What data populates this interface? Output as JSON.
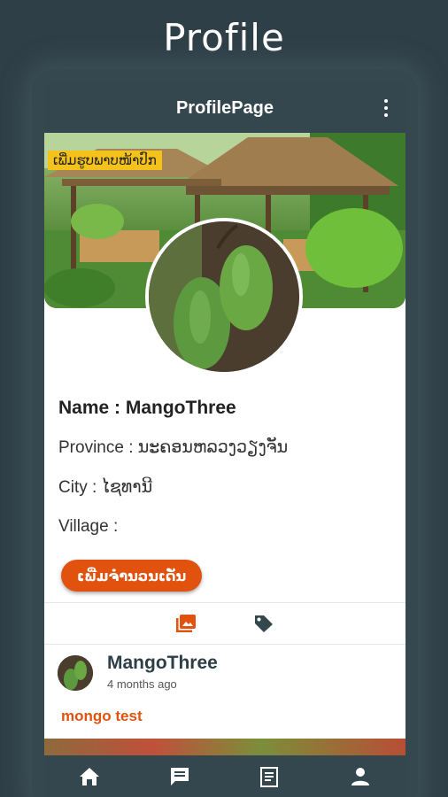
{
  "promo": {
    "title": "Profile"
  },
  "appbar": {
    "title": "ProfilePage",
    "menu_icon": "more-vert-icon"
  },
  "cover": {
    "badge_label": "ເພີ່ມຮູບພາບໜ້າປົກ"
  },
  "profile": {
    "name_line": "Name : MangoThree",
    "province_line": "Province : ນະຄອນຫລວງວຽງຈັນ",
    "city_line": "City : ໄຊທານີ",
    "village_line": "Village :",
    "add_points_label": "ເພີ່ມຈຳນວນເດັ່ນ"
  },
  "tabs": [
    {
      "icon": "photo-library-icon",
      "active": true
    },
    {
      "icon": "tag-icon",
      "active": false
    }
  ],
  "post": {
    "username": "MangoThree",
    "time": "4 months ago",
    "text": "mongo test"
  },
  "bottom_nav": [
    {
      "icon": "home-icon"
    },
    {
      "icon": "chat-icon"
    },
    {
      "icon": "news-icon"
    },
    {
      "icon": "person-icon"
    }
  ],
  "colors": {
    "background": "#2f3f47",
    "bar": "#34474f",
    "accent": "#e0520e",
    "badge": "#f4c21a"
  }
}
